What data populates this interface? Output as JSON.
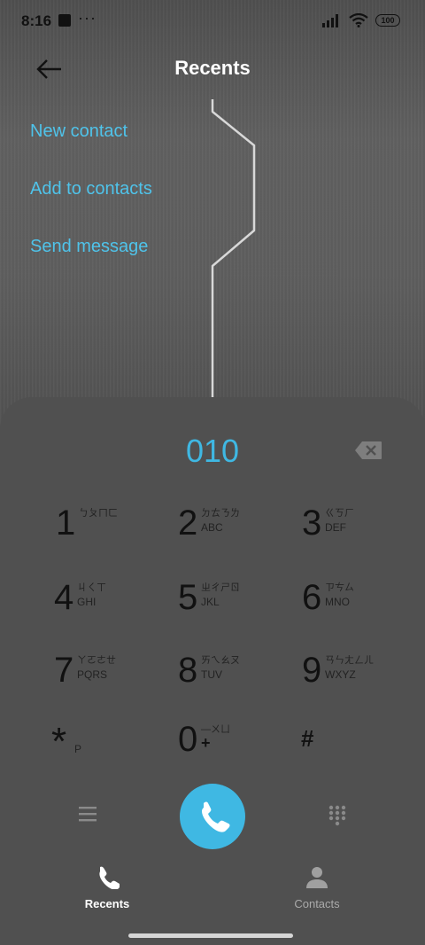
{
  "status_bar": {
    "time": "8:16",
    "dots": "···",
    "battery": "100"
  },
  "header": {
    "title": "Recents"
  },
  "menu": {
    "items": [
      "New contact",
      "Add to contacts",
      "Send message"
    ]
  },
  "dialer": {
    "number": "010",
    "keys": [
      {
        "digit": "1",
        "zhuyin": "ㄅㄆㄇㄈ",
        "letters": ""
      },
      {
        "digit": "2",
        "zhuyin": "ㄉㄊㄋㄌ",
        "letters": "ABC"
      },
      {
        "digit": "3",
        "zhuyin": "ㄍㄎㄏ",
        "letters": "DEF"
      },
      {
        "digit": "4",
        "zhuyin": "ㄐㄑㄒ",
        "letters": "GHI"
      },
      {
        "digit": "5",
        "zhuyin": "ㄓㄔㄕㄖ",
        "letters": "JKL"
      },
      {
        "digit": "6",
        "zhuyin": "ㄗㄘㄙ",
        "letters": "MNO"
      },
      {
        "digit": "7",
        "zhuyin": "ㄚㄛㄜㄝ",
        "letters": "PQRS"
      },
      {
        "digit": "8",
        "zhuyin": "ㄞㄟㄠㄡ",
        "letters": "TUV"
      },
      {
        "digit": "9",
        "zhuyin": "ㄢㄣㄤㄥㄦ",
        "letters": "WXYZ"
      },
      {
        "digit": "*",
        "zhuyin": "",
        "letters": "P"
      },
      {
        "digit": "0",
        "zhuyin": "—ㄨㄩ",
        "letters": "+"
      },
      {
        "digit": "#",
        "zhuyin": "",
        "letters": ""
      }
    ]
  },
  "bottom_nav": {
    "recents_label": "Recents",
    "contacts_label": "Contacts"
  },
  "colors": {
    "accent": "#3fb8e3",
    "link": "#4fc3ea",
    "dialer_bg": "#505050"
  },
  "icons": [
    "back-arrow-icon",
    "backspace-icon",
    "menu-icon",
    "phone-icon",
    "dialpad-icon",
    "contacts-person-icon",
    "signal-icon",
    "wifi-icon"
  ]
}
